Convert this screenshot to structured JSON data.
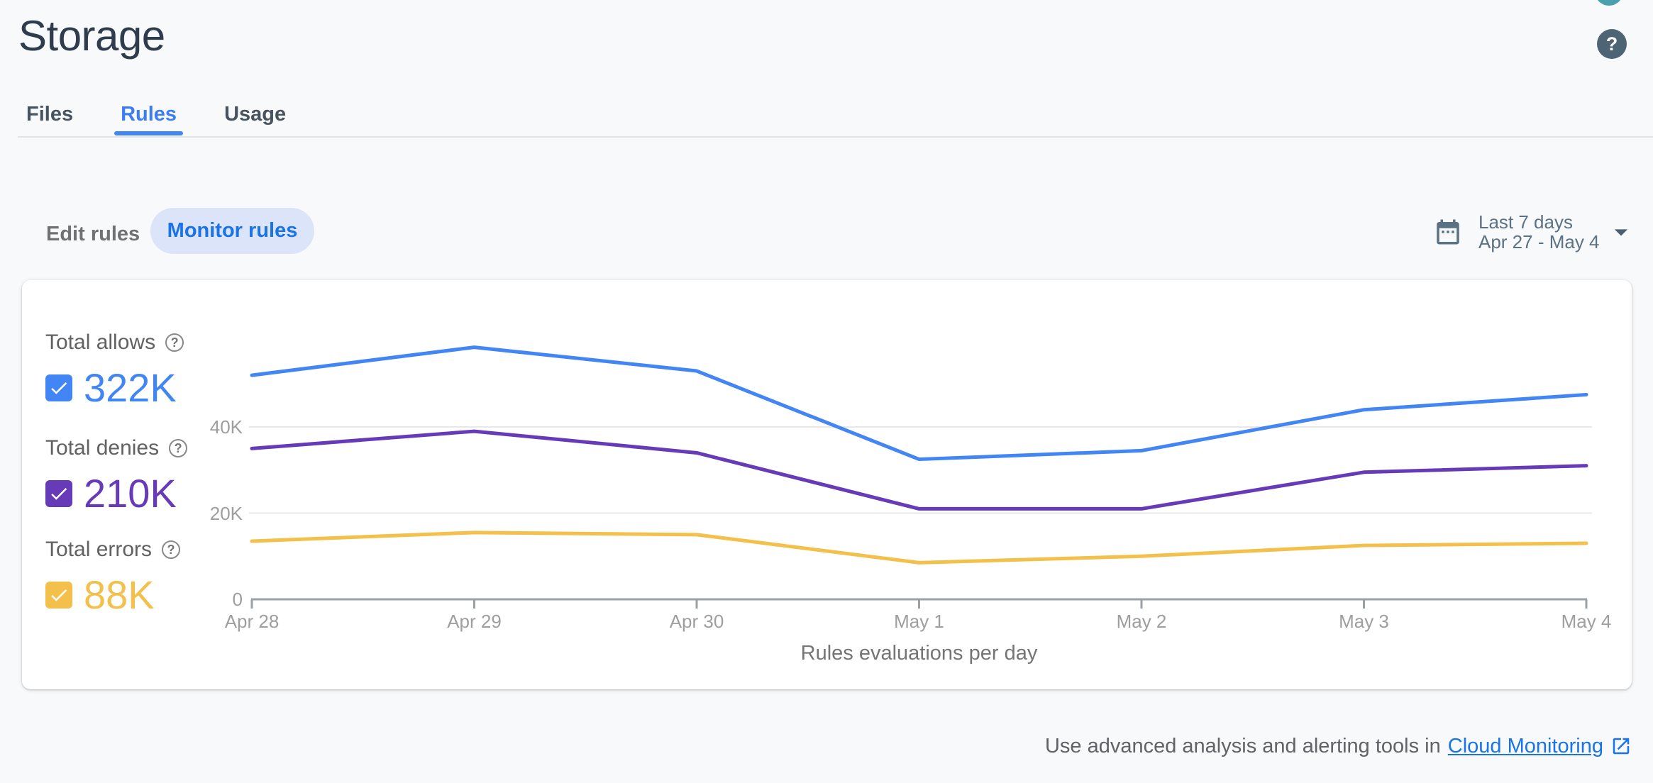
{
  "header": {
    "title": "Storage",
    "help_label": "?"
  },
  "tabs": [
    {
      "label": "Files",
      "active": false
    },
    {
      "label": "Rules",
      "active": true
    },
    {
      "label": "Usage",
      "active": false
    }
  ],
  "controls": {
    "edit_label": "Edit rules",
    "monitor_label": "Monitor rules",
    "date_range": {
      "line1": "Last 7 days",
      "line2": "Apr 27 - May 4"
    }
  },
  "legend": [
    {
      "label": "Total allows",
      "value": "322K",
      "color": "#4285f4",
      "help": "?"
    },
    {
      "label": "Total denies",
      "value": "210K",
      "color": "#673ab7",
      "help": "?"
    },
    {
      "label": "Total errors",
      "value": "88K",
      "color": "#f2c04b",
      "help": "?"
    }
  ],
  "chart_data": {
    "type": "line",
    "title": "Rules evaluations per day",
    "xlabel": "",
    "ylabel": "",
    "x": [
      "Apr 28",
      "Apr 29",
      "Apr 30",
      "May 1",
      "May 2",
      "May 3",
      "May 4"
    ],
    "yticks": [
      "0",
      "20K",
      "40K"
    ],
    "ylim": [
      0,
      46000
    ],
    "grid": true,
    "legend_position": "left",
    "series": [
      {
        "name": "Total allows",
        "color": "#4285f4",
        "values": [
          52000,
          58500,
          53000,
          32500,
          34500,
          44000,
          47500
        ]
      },
      {
        "name": "Total denies",
        "color": "#673ab7",
        "values": [
          35000,
          39000,
          34000,
          21000,
          21000,
          29500,
          31000
        ]
      },
      {
        "name": "Total errors",
        "color": "#f2c04b",
        "values": [
          13500,
          15500,
          15000,
          8500,
          10000,
          12500,
          13000
        ]
      }
    ]
  },
  "footer": {
    "text": "Use advanced analysis and alerting tools in",
    "link_label": "Cloud Monitoring"
  }
}
